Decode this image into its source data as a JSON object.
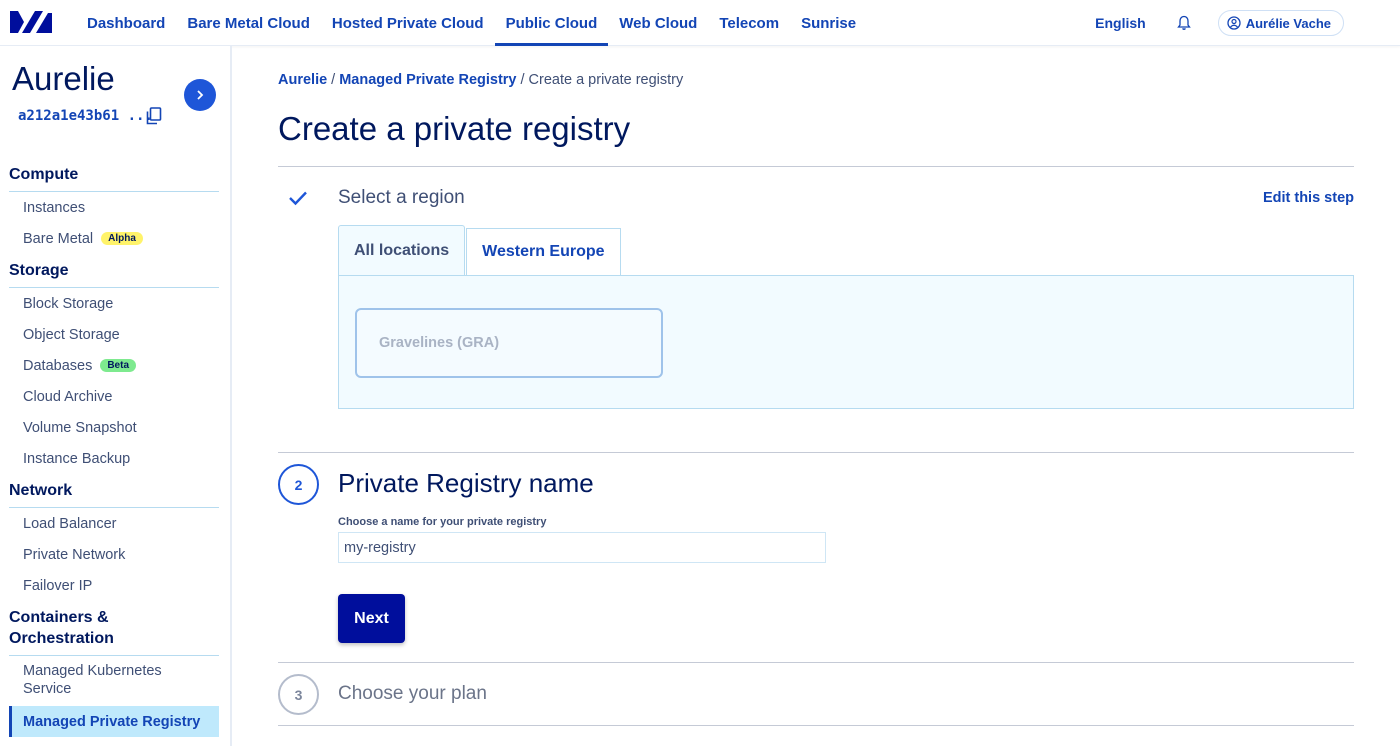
{
  "topnav": {
    "logo_icon": "ovh-logo-icon",
    "items": [
      {
        "label": "Dashboard",
        "active": false
      },
      {
        "label": "Bare Metal Cloud",
        "active": false
      },
      {
        "label": "Hosted Private Cloud",
        "active": false
      },
      {
        "label": "Public Cloud",
        "active": true
      },
      {
        "label": "Web Cloud",
        "active": false
      },
      {
        "label": "Telecom",
        "active": false
      },
      {
        "label": "Sunrise",
        "active": false
      }
    ],
    "language": "English",
    "notification_icon": "bell-icon",
    "user_name": "Aurélie Vache"
  },
  "sidebar": {
    "project_name": "Aurelie",
    "project_id": "a212a1e43b61 ...",
    "sections": [
      {
        "title": "Compute",
        "items": [
          {
            "label": "Instances"
          },
          {
            "label": "Bare Metal",
            "badge": "Alpha"
          }
        ]
      },
      {
        "title": "Storage",
        "items": [
          {
            "label": "Block Storage"
          },
          {
            "label": "Object Storage"
          },
          {
            "label": "Databases",
            "badge": "Beta"
          },
          {
            "label": "Cloud Archive"
          },
          {
            "label": "Volume Snapshot"
          },
          {
            "label": "Instance Backup"
          }
        ]
      },
      {
        "title": "Network",
        "items": [
          {
            "label": "Load Balancer"
          },
          {
            "label": "Private Network"
          },
          {
            "label": "Failover IP"
          }
        ]
      },
      {
        "title": "Containers & Orchestration",
        "items": [
          {
            "label": "Managed Kubernetes Service"
          },
          {
            "label": "Managed Private Registry",
            "active": true
          }
        ]
      }
    ]
  },
  "breadcrumb": {
    "items": [
      "Aurelie",
      "Managed Private Registry"
    ],
    "current": "Create a private registry"
  },
  "page": {
    "title": "Create a private registry"
  },
  "step1": {
    "title": "Select a region",
    "edit_label": "Edit this step",
    "tabs": [
      "All locations",
      "Western Europe"
    ],
    "region": "Gravelines (GRA)"
  },
  "step2": {
    "number": "2",
    "title": "Private Registry name",
    "field_label": "Choose a name for your private registry",
    "field_value": "my-registry",
    "next_label": "Next"
  },
  "step3": {
    "number": "3",
    "title": "Choose your plan"
  },
  "colors": {
    "accent": "#1345b5",
    "primary_button": "#000e9c",
    "active_menu_bg": "#bfe9fc"
  }
}
